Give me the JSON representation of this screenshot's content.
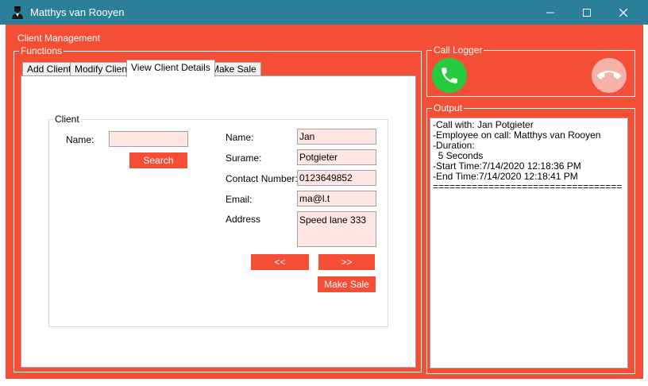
{
  "window": {
    "title": "Matthys van Rooyen",
    "minimize_icon": "minimize-icon",
    "maximize_icon": "maximize-icon",
    "close_icon": "close-icon"
  },
  "menu": {
    "label": "Client Management"
  },
  "functions": {
    "title": "Functions",
    "tabs": [
      "Add Client",
      "Modify Client",
      "View Client Details",
      "Make Sale"
    ],
    "active_tab": "View Client Details"
  },
  "client_group": {
    "title": "Client",
    "search_name_label": "Name:",
    "search_name_value": "",
    "search_button": "Search",
    "fields": {
      "name_label": "Name:",
      "name_value": "Jan",
      "surname_label": "Surame:",
      "surname_value": "Potgieter",
      "contact_label": "Contact Number:",
      "contact_value": "0123649852",
      "email_label": "Email:",
      "email_value": "ma@l.t",
      "address_label": "Address",
      "address_value": "Speed lane 333"
    },
    "prev_button": "<<",
    "next_button": ">>",
    "make_sale_button": "Make Sale"
  },
  "call_logger": {
    "title": "Call Logger",
    "answer_icon": "phone-answer-icon",
    "hangup_icon": "phone-hangup-icon"
  },
  "output": {
    "title": "Output",
    "lines": [
      "-Call with: Jan Potgieter",
      "-Employee on call: Matthys van Rooyen",
      "-Duration:",
      "  5 Seconds",
      "-Start Time:7/14/2020 12:18:36 PM",
      "-End Time:7/14/2020 12:18:41 PM",
      "=================================="
    ]
  },
  "colors": {
    "titlebar": "#2c7f98",
    "form_background": "#f44e37",
    "textbox_background": "#ffe6e3",
    "answer_green": "#27c93f",
    "hangup_pink": "#f5b2a7"
  }
}
